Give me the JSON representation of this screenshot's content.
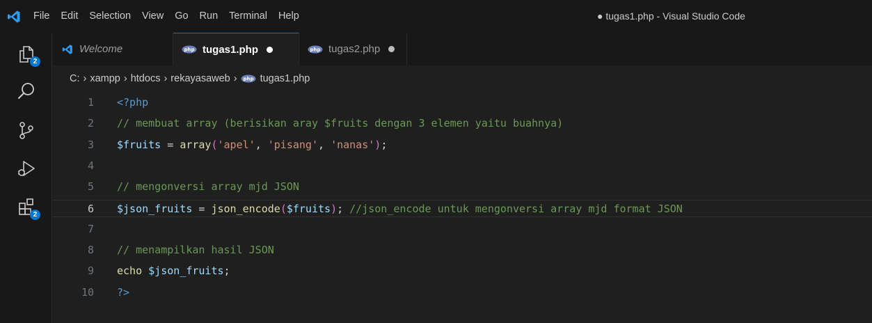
{
  "titlebar": {
    "menu": [
      "File",
      "Edit",
      "Selection",
      "View",
      "Go",
      "Run",
      "Terminal",
      "Help"
    ],
    "window_title": "● tugas1.php - Visual Studio Code"
  },
  "activity_bar": {
    "explorer_badge": "2",
    "extensions_badge": "2"
  },
  "tabs": [
    {
      "label": "Welcome",
      "icon": "vscode-icon",
      "active": false,
      "unsaved": false
    },
    {
      "label": "tugas1.php",
      "icon": "php-icon",
      "active": true,
      "unsaved": true
    },
    {
      "label": "tugas2.php",
      "icon": "php-icon",
      "active": false,
      "unsaved": true
    }
  ],
  "breadcrumb": [
    "C:",
    "xampp",
    "htdocs",
    "rekayasaweb",
    "tugas1.php"
  ],
  "editor": {
    "current_line": 6,
    "lines": [
      {
        "n": "1",
        "tokens": [
          {
            "t": "<?php",
            "c": "tag"
          }
        ]
      },
      {
        "n": "2",
        "tokens": [
          {
            "t": "// membuat array (berisikan aray $fruits dengan 3 elemen yaitu buahnya)",
            "c": "comment"
          }
        ]
      },
      {
        "n": "3",
        "tokens": [
          {
            "t": "$fruits",
            "c": "var"
          },
          {
            "t": " = ",
            "c": "op"
          },
          {
            "t": "array",
            "c": "fn"
          },
          {
            "t": "(",
            "c": "paren"
          },
          {
            "t": "'apel'",
            "c": "str"
          },
          {
            "t": ", ",
            "c": "op"
          },
          {
            "t": "'pisang'",
            "c": "str"
          },
          {
            "t": ", ",
            "c": "op"
          },
          {
            "t": "'nanas'",
            "c": "str"
          },
          {
            "t": ")",
            "c": "paren"
          },
          {
            "t": ";",
            "c": "op"
          }
        ]
      },
      {
        "n": "4",
        "tokens": []
      },
      {
        "n": "5",
        "tokens": [
          {
            "t": "// mengonversi array mjd JSON",
            "c": "comment"
          }
        ]
      },
      {
        "n": "6",
        "tokens": [
          {
            "t": "$json_fruits",
            "c": "var"
          },
          {
            "t": " = ",
            "c": "op"
          },
          {
            "t": "json_encode",
            "c": "fn"
          },
          {
            "t": "(",
            "c": "paren"
          },
          {
            "t": "$fruits",
            "c": "var"
          },
          {
            "t": ")",
            "c": "paren"
          },
          {
            "t": "; ",
            "c": "op"
          },
          {
            "t": "//json_encode untuk mengonversi array mjd format JSON",
            "c": "comment"
          }
        ]
      },
      {
        "n": "7",
        "tokens": []
      },
      {
        "n": "8",
        "tokens": [
          {
            "t": "// menampilkan hasil JSON",
            "c": "comment"
          }
        ]
      },
      {
        "n": "9",
        "tokens": [
          {
            "t": "echo ",
            "c": "kw"
          },
          {
            "t": "$json_fruits",
            "c": "var"
          },
          {
            "t": ";",
            "c": "op"
          }
        ]
      },
      {
        "n": "10",
        "tokens": [
          {
            "t": "?>",
            "c": "tag"
          }
        ]
      }
    ]
  },
  "colors": {
    "accent": "#0078d4",
    "background": "#1f1f1f",
    "chrome": "#181818"
  }
}
